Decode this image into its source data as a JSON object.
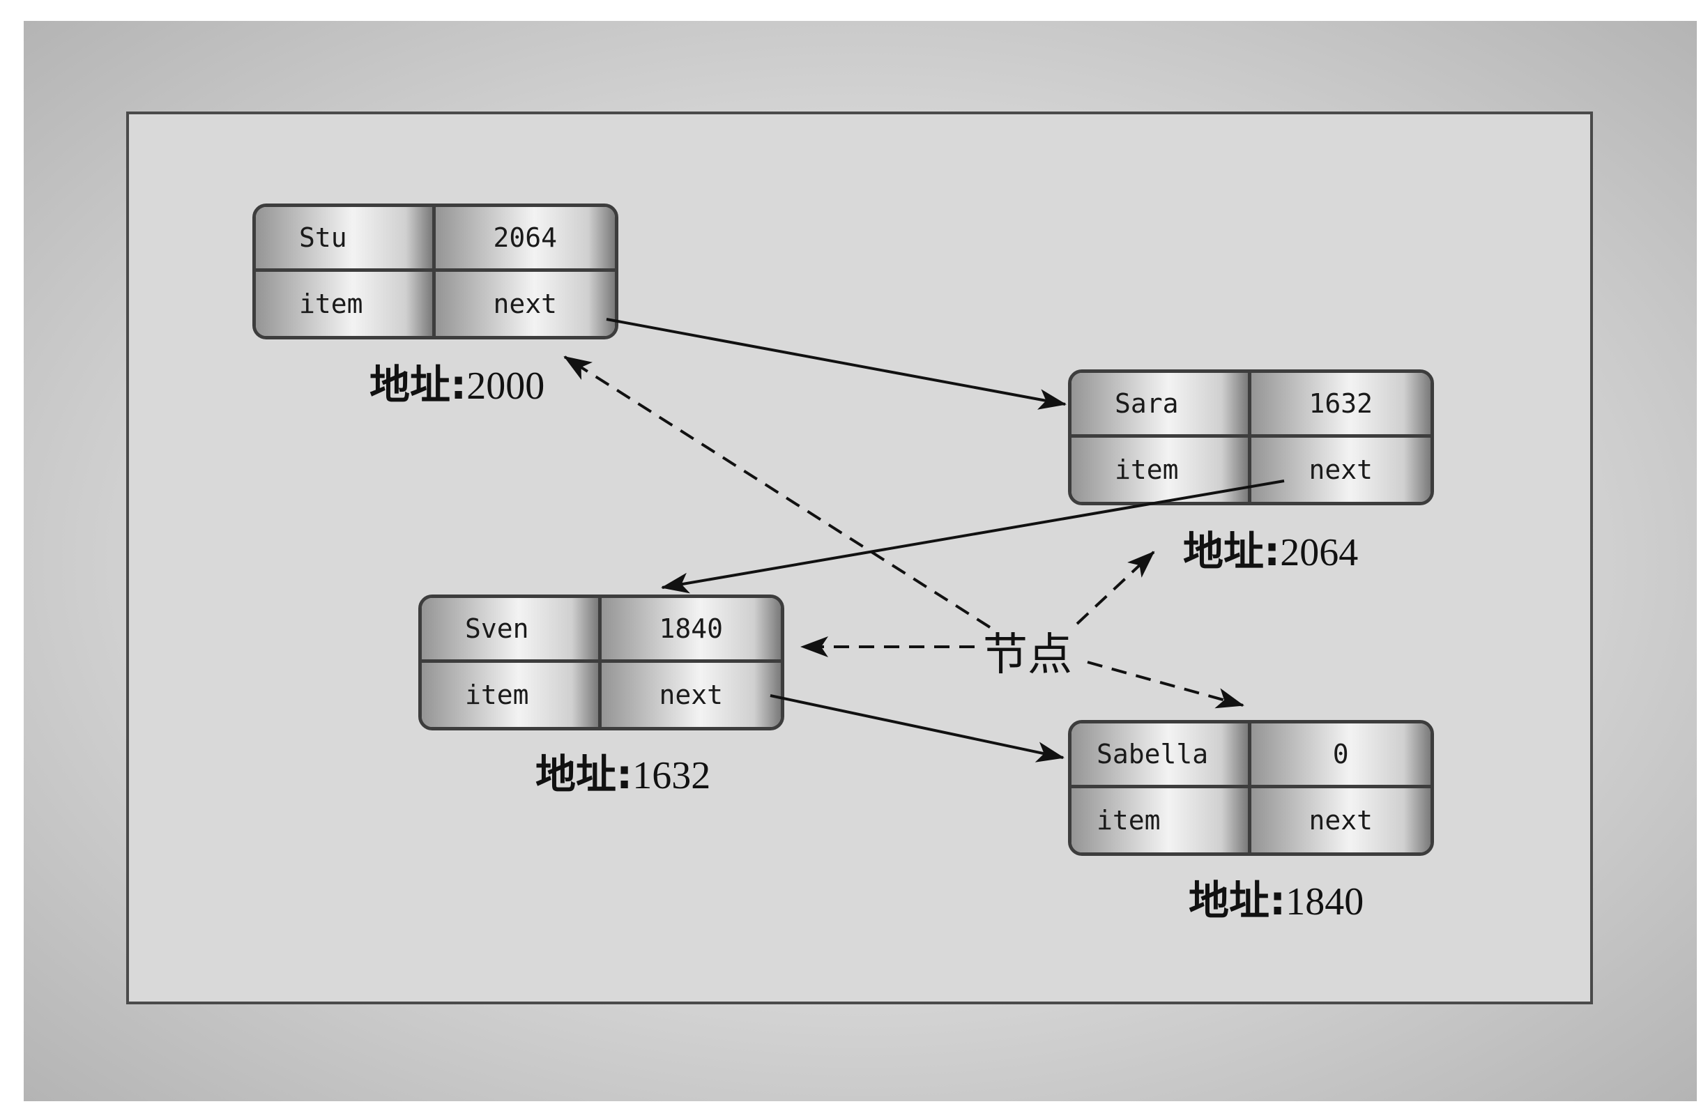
{
  "nodes": [
    {
      "id": "stu",
      "item_value": "Stu",
      "next_value": "2064",
      "item_label": "item",
      "next_label": "next",
      "address_key": "地址:",
      "address_value": "2000"
    },
    {
      "id": "sara",
      "item_value": "Sara",
      "next_value": "1632",
      "item_label": "item",
      "next_label": "next",
      "address_key": "地址:",
      "address_value": "2064"
    },
    {
      "id": "sven",
      "item_value": "Sven",
      "next_value": "1840",
      "item_label": "item",
      "next_label": "next",
      "address_key": "地址:",
      "address_value": "1632"
    },
    {
      "id": "sabella",
      "item_value": "Sabella",
      "next_value": "0",
      "item_label": "item",
      "next_label": "next",
      "address_key": "地址:",
      "address_value": "1840"
    }
  ],
  "node_label": "节点"
}
